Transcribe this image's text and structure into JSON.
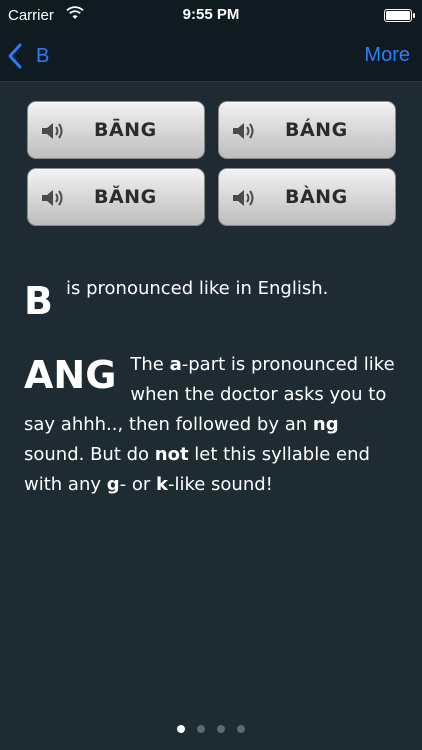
{
  "status": {
    "carrier": "Carrier",
    "time": "9:55 PM"
  },
  "nav": {
    "back_label": "B",
    "more_label": "More"
  },
  "sounds": [
    {
      "label": "BĀNG",
      "icon": "speaker-icon"
    },
    {
      "label": "BÁNG",
      "icon": "speaker-icon"
    },
    {
      "label": "BǍNG",
      "icon": "speaker-icon"
    },
    {
      "label": "BÀNG",
      "icon": "speaker-icon"
    }
  ],
  "description": {
    "initial": "B",
    "initial_text": "is pronounced like in English.",
    "final": "ANG",
    "final_text": {
      "p1": "The ",
      "p2": "a",
      "p3": "-part is pronounced like when the doctor asks you to say ahhh.., then followed by an ",
      "p4": "ng",
      "p5": " sound. But do ",
      "p6": "not",
      "p7": " let this syllable end with any ",
      "p8": "g",
      "p9": "- or ",
      "p10": "k",
      "p11": "-like sound!"
    }
  },
  "pager": {
    "pages": 4,
    "current": 1
  },
  "colors": {
    "background": "#1e2b33",
    "bar": "#0f1a21",
    "accent": "#2a7ff5"
  }
}
